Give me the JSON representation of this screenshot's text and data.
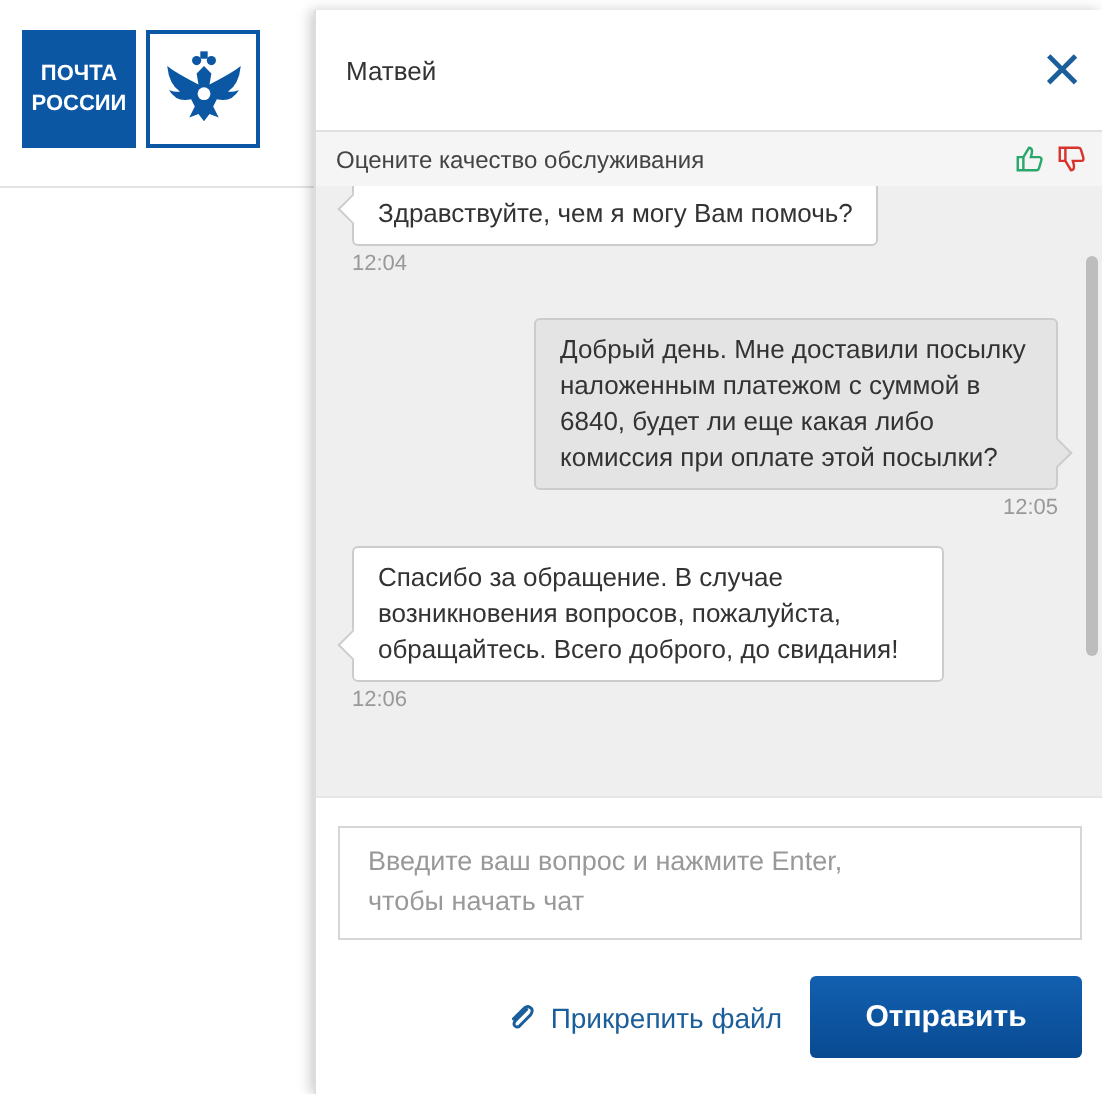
{
  "logo": {
    "lines": [
      "ПОЧТА",
      "РОССИИ"
    ]
  },
  "chat": {
    "operator": "Матвей",
    "close": "×",
    "rating": {
      "label": "Оцените качество обслуживания"
    },
    "messages": [
      {
        "kind": "incoming",
        "text": "Здравствуйте, чем я могу Вам помочь?",
        "time": "12:04"
      },
      {
        "kind": "outgoing",
        "text": "Добрый день. Мне доставили посылку наложенным платежом с суммой в 6840, будет ли еще какая либо комиссия при оплате этой посылки?",
        "time": "12:05"
      },
      {
        "kind": "incoming",
        "text": "Спасибо за обращение. В случае возникновения вопросов, пожалуйста, обращайтесь. Всего доброго, до свидания!",
        "time": "12:06"
      }
    ],
    "input": {
      "placeholder": "Введите ваш вопрос и нажмите Enter, чтобы начать чат"
    },
    "attach": "Прикрепить файл",
    "send": "Отправить"
  }
}
